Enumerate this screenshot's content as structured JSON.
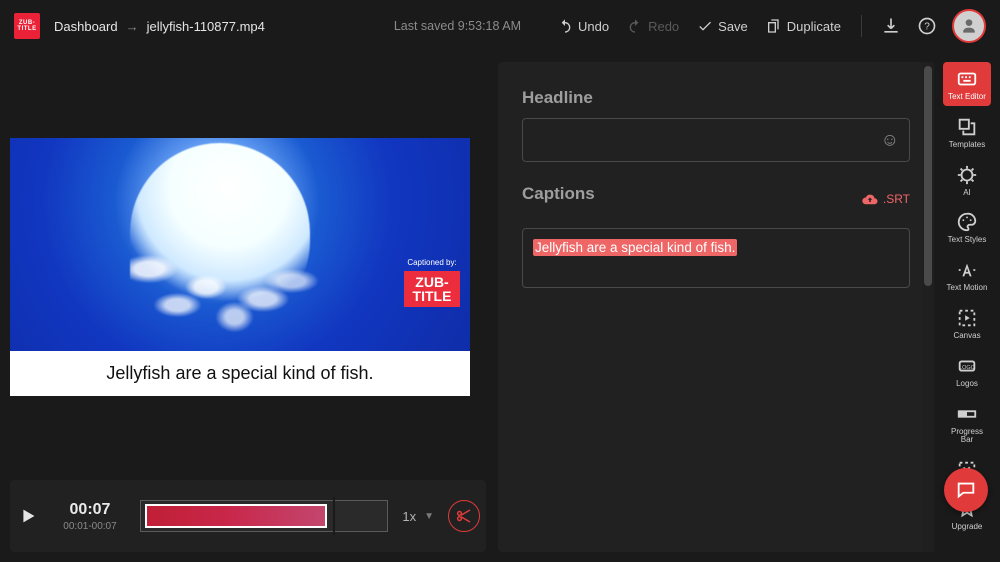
{
  "header": {
    "breadcrumb": {
      "root": "Dashboard",
      "file": "jellyfish-110877.mp4"
    },
    "last_saved": "Last saved 9:53:18 AM",
    "undo": "Undo",
    "redo": "Redo",
    "save": "Save",
    "duplicate": "Duplicate"
  },
  "preview": {
    "watermark_label": "Captioned by:",
    "watermark_brand_top": "ZUB-",
    "watermark_brand_bottom": "TITLE",
    "caption_text": "Jellyfish are a special kind of fish."
  },
  "playback": {
    "current": "00:07",
    "range": "00:01-00:07",
    "speed": "1x"
  },
  "panel": {
    "headline_label": "Headline",
    "headline_value": "",
    "captions_label": "Captions",
    "srt_label": ".SRT",
    "caption_line": "Jellyfish are a special kind of fish."
  },
  "tools": {
    "text_editor": "Text Editor",
    "templates": "Templates",
    "ai": "AI",
    "text_styles": "Text Styles",
    "text_motion": "Text Motion",
    "canvas": "Canvas",
    "logos": "Logos",
    "progress_bar": "Progress Bar",
    "upgrade": "Upgrade"
  },
  "colors": {
    "accent": "#e03a3a"
  }
}
